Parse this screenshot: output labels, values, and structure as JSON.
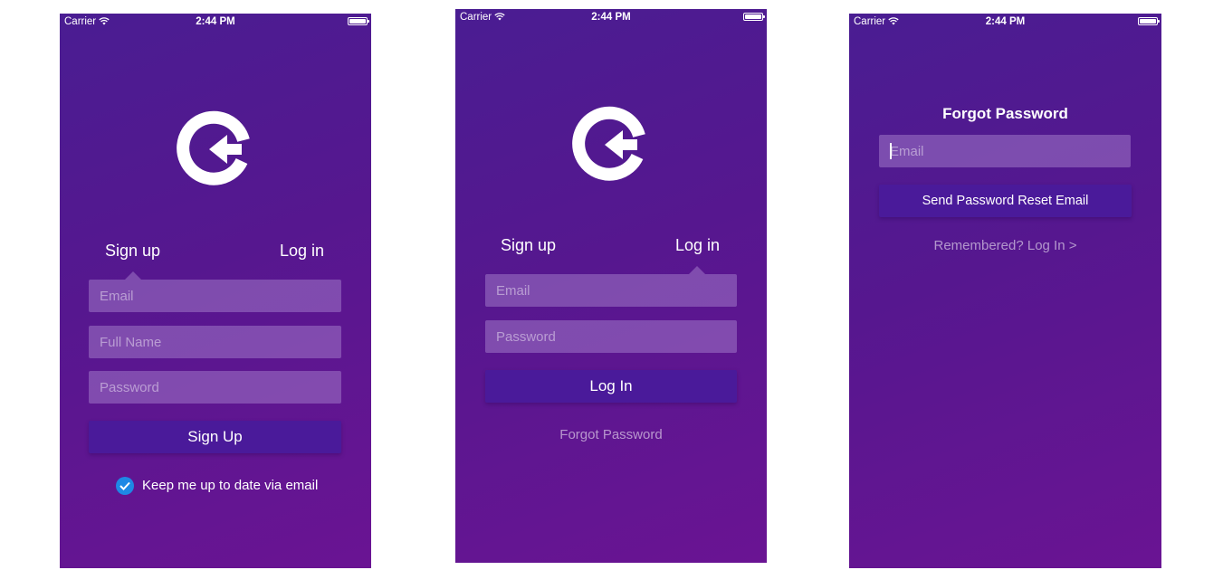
{
  "status_bar": {
    "carrier": "Carrier",
    "time": "2:44 PM"
  },
  "signup_screen": {
    "tabs": {
      "signup": "Sign up",
      "login": "Log in"
    },
    "email_placeholder": "Email",
    "fullname_placeholder": "Full Name",
    "password_placeholder": "Password",
    "submit_label": "Sign Up",
    "checkbox_label": "Keep me up to date via email",
    "checkbox_checked": true
  },
  "login_screen": {
    "tabs": {
      "signup": "Sign up",
      "login": "Log in"
    },
    "email_placeholder": "Email",
    "password_placeholder": "Password",
    "submit_label": "Log In",
    "forgot_label": "Forgot Password"
  },
  "forgot_screen": {
    "title": "Forgot Password",
    "email_placeholder": "Email",
    "submit_label": "Send Password Reset Email",
    "back_link": "Remembered? Log In >"
  },
  "colors": {
    "background_start": "#4a1d92",
    "background_end": "#6a1493",
    "button": "#4a1a9a",
    "checkbox": "#1e88e5"
  },
  "icons": [
    "wifi-icon",
    "battery-icon",
    "logo-icon",
    "checkmark-icon"
  ]
}
